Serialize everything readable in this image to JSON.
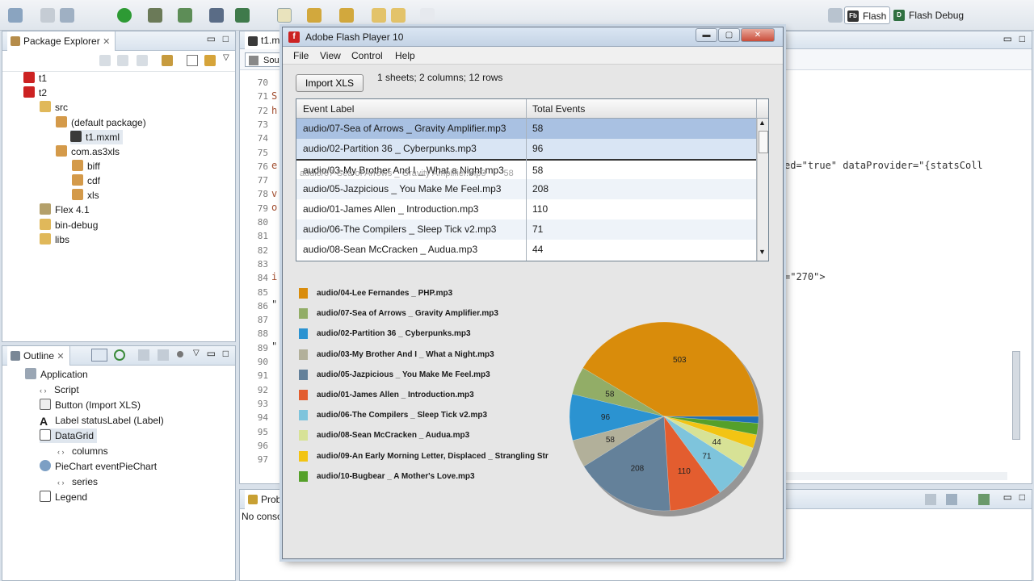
{
  "toolbar": {
    "perspective_flash": "Flash",
    "perspective_flash_debug": "Flash Debug"
  },
  "package_explorer": {
    "title": "Package Explorer",
    "items": [
      {
        "label": "t1"
      },
      {
        "label": "t2"
      },
      {
        "label": "src"
      },
      {
        "label": "(default package)"
      },
      {
        "label": "t1.mxml"
      },
      {
        "label": "com.as3xls"
      },
      {
        "label": "biff"
      },
      {
        "label": "cdf"
      },
      {
        "label": "xls"
      },
      {
        "label": "Flex 4.1"
      },
      {
        "label": "bin-debug"
      },
      {
        "label": "libs"
      }
    ]
  },
  "outline": {
    "title": "Outline",
    "items": [
      {
        "label": "Application"
      },
      {
        "label": "Script"
      },
      {
        "label": "Button (Import XLS)"
      },
      {
        "label": "Label statusLabel (Label)"
      },
      {
        "label": "DataGrid"
      },
      {
        "label": "columns"
      },
      {
        "label": "PieChart eventPieChart"
      },
      {
        "label": "series"
      },
      {
        "label": "Legend"
      }
    ]
  },
  "editor": {
    "tab": "t1.m",
    "source_tab": "Sou",
    "line_numbers": [
      "70",
      "71",
      "72",
      "73",
      "74",
      "75",
      "76",
      "77",
      "78",
      "79",
      "80",
      "81",
      "82",
      "83",
      "84",
      "85",
      "86",
      "87",
      "88",
      "89",
      "90",
      "91",
      "92",
      "93",
      "94",
      "95",
      "96",
      "97"
    ],
    "code_line_dataprovider": "ed=\"true\" dataProvider=\"{statsColl",
    "code_line_270": "=\"270\">",
    "frag_71": "S",
    "frag_72": "h",
    "frag_76": "e",
    "frag_78": "v",
    "frag_79": "o",
    "frag_84": "i",
    "frag_86": "\"",
    "frag_89": "\""
  },
  "problems": {
    "tab": "Probl",
    "status": "No conso"
  },
  "flash_window": {
    "title": "Adobe Flash Player 10",
    "menu": [
      "File",
      "View",
      "Control",
      "Help"
    ],
    "import_button": "Import XLS",
    "status": "1 sheets; 2 columns; 12 rows",
    "grid": {
      "columns": [
        "Event Label",
        "Total Events"
      ],
      "rows": [
        {
          "label": "audio/07-Sea of Arrows _ Gravity Amplifier.mp3",
          "value": "58"
        },
        {
          "label": "audio/02-Partition 36 _ Cyberpunks.mp3",
          "value": "96"
        },
        {
          "label": "audio/03-My Brother And I _ What a Night.mp3",
          "value": "58"
        },
        {
          "label": "audio/05-Jazpicious _ You Make Me Feel.mp3",
          "value": "208"
        },
        {
          "label": "audio/01-James Allen _ Introduction.mp3",
          "value": "110"
        },
        {
          "label": "audio/06-The Compilers _ Sleep Tick v2.mp3",
          "value": "71"
        },
        {
          "label": "audio/08-Sean McCracken _ Audua.mp3",
          "value": "44"
        }
      ],
      "drag_ghost_label": "audio/07-Sea of Arrows _ Gravity Amplifier.mp3",
      "drag_ghost_value": "58"
    },
    "legend": [
      {
        "label": "audio/04-Lee Fernandes _ PHP.mp3",
        "color": "#d98c0b"
      },
      {
        "label": "audio/07-Sea of Arrows _ Gravity Amplifier.mp3",
        "color": "#92ad67"
      },
      {
        "label": "audio/02-Partition 36 _ Cyberpunks.mp3",
        "color": "#2b93d1"
      },
      {
        "label": "audio/03-My Brother And I _ What a Night.mp3",
        "color": "#b2b09a"
      },
      {
        "label": "audio/05-Jazpicious _ You Make Me Feel.mp3",
        "color": "#64819a"
      },
      {
        "label": "audio/01-James Allen _ Introduction.mp3",
        "color": "#e35d2f"
      },
      {
        "label": "audio/06-The Compilers _ Sleep Tick v2.mp3",
        "color": "#7ec4dc"
      },
      {
        "label": "audio/08-Sean McCracken _ Audua.mp3",
        "color": "#d7e296"
      },
      {
        "label": "audio/09-An Early Morning Letter, Displaced _ Strangling Str",
        "color": "#f2c413"
      },
      {
        "label": "audio/10-Bugbear _ A Mother's Love.mp3",
        "color": "#55a02a"
      }
    ]
  },
  "chart_data": {
    "type": "pie",
    "slices": [
      {
        "label": "audio/04-Lee Fernandes _ PHP.mp3",
        "value": 503,
        "color": "#d98c0b",
        "show_label": true
      },
      {
        "label": "audio/07-Sea of Arrows _ Gravity Amplifier.mp3",
        "value": 58,
        "color": "#92ad67",
        "show_label": true
      },
      {
        "label": "audio/02-Partition 36 _ Cyberpunks.mp3",
        "value": 96,
        "color": "#2b93d1",
        "show_label": true
      },
      {
        "label": "audio/03-My Brother And I _ What a Night.mp3",
        "value": 58,
        "color": "#b2b09a",
        "show_label": true
      },
      {
        "label": "audio/05-Jazpicious _ You Make Me Feel.mp3",
        "value": 208,
        "color": "#64819a",
        "show_label": true
      },
      {
        "label": "audio/01-James Allen _ Introduction.mp3",
        "value": 110,
        "color": "#e35d2f",
        "show_label": true
      },
      {
        "label": "audio/06-The Compilers _ Sleep Tick v2.mp3",
        "value": 71,
        "color": "#7ec4dc",
        "show_label": true
      },
      {
        "label": "audio/08-Sean McCracken _ Audua.mp3",
        "value": 44,
        "color": "#d7e296",
        "show_label": true
      },
      {
        "label": "audio/09-An Early Morning Letter, Displaced _ Strangling Str",
        "value": 28,
        "color": "#f2c413",
        "show_label": false
      },
      {
        "label": "audio/10-Bugbear _ A Mother's Love.mp3",
        "value": 24,
        "color": "#55a02a",
        "show_label": false
      },
      {
        "label": "",
        "value": 14,
        "color": "#1f6fb5",
        "show_label": false
      }
    ]
  }
}
